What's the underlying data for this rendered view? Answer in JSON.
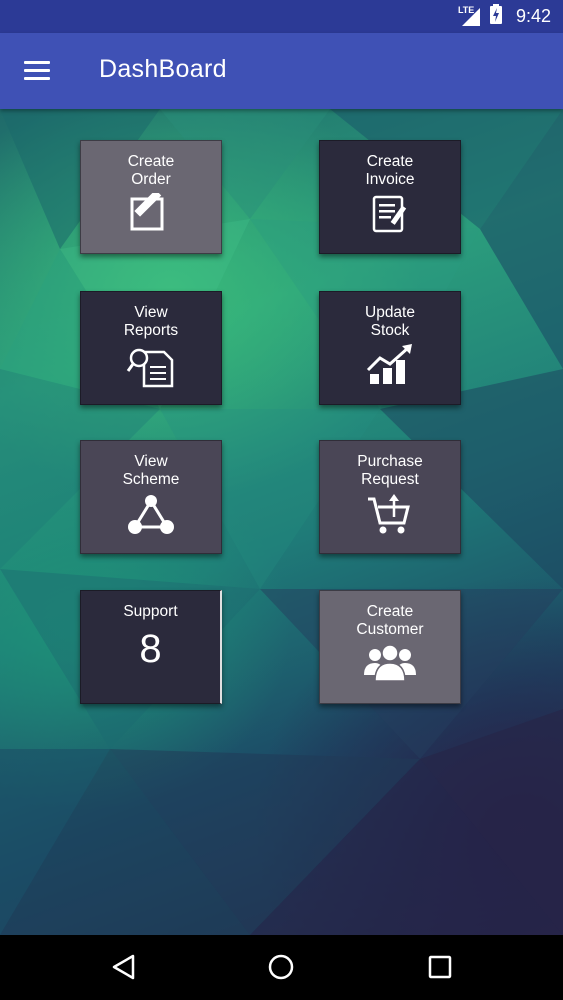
{
  "status_bar": {
    "network": "LTE",
    "time": "9:42"
  },
  "app_bar": {
    "title": "DashBoard"
  },
  "tiles": {
    "create_order": {
      "label": "Create\nOrder"
    },
    "create_invoice": {
      "label": "Create\nInvoice"
    },
    "view_reports": {
      "label": "View\nReports"
    },
    "update_stock": {
      "label": "Update\nStock"
    },
    "view_scheme": {
      "label": "View\nScheme"
    },
    "purchase_request": {
      "label": "Purchase\nRequest"
    },
    "support": {
      "label": "Support",
      "count": "8"
    },
    "create_customer": {
      "label": "Create\nCustomer"
    }
  },
  "icons": {
    "menu": "hamburger-icon",
    "create_order": "edit-icon",
    "create_invoice": "invoice-icon",
    "view_reports": "report-search-icon",
    "update_stock": "chart-up-icon",
    "view_scheme": "triangle-nodes-icon",
    "purchase_request": "cart-upload-icon",
    "create_customer": "group-icon",
    "back": "back-icon",
    "home": "home-icon",
    "recents": "recents-icon"
  },
  "colors": {
    "status_bar": "#2c3a96",
    "app_bar": "#3f51b5",
    "tile_dark": "#2b2a3c",
    "tile_mid": "#4a4656",
    "tile_light": "#6a6772"
  }
}
